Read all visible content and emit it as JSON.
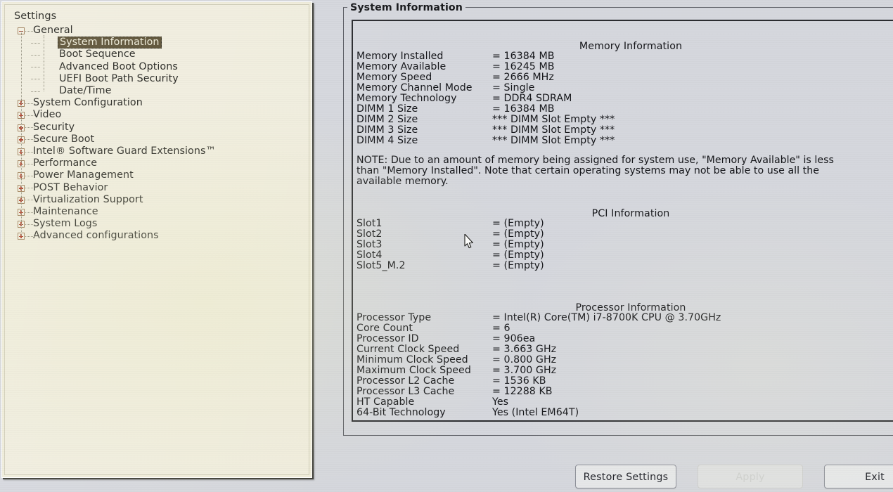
{
  "sidebar": {
    "root_label": "Settings",
    "tree": [
      {
        "label": "General",
        "depth": 1,
        "expander": "minus",
        "selected": false
      },
      {
        "label": "System Information",
        "depth": 2,
        "expander": "none",
        "selected": true
      },
      {
        "label": "Boot Sequence",
        "depth": 2,
        "expander": "none",
        "selected": false
      },
      {
        "label": "Advanced Boot Options",
        "depth": 2,
        "expander": "none",
        "selected": false
      },
      {
        "label": "UEFI Boot Path Security",
        "depth": 2,
        "expander": "none",
        "selected": false
      },
      {
        "label": "Date/Time",
        "depth": 2,
        "expander": "none",
        "selected": false
      },
      {
        "label": "System Configuration",
        "depth": 1,
        "expander": "plus",
        "selected": false
      },
      {
        "label": "Video",
        "depth": 1,
        "expander": "plus",
        "selected": false
      },
      {
        "label": "Security",
        "depth": 1,
        "expander": "plus",
        "selected": false
      },
      {
        "label": "Secure Boot",
        "depth": 1,
        "expander": "plus",
        "selected": false
      },
      {
        "label": "Intel® Software Guard Extensions™",
        "depth": 1,
        "expander": "plus",
        "selected": false
      },
      {
        "label": "Performance",
        "depth": 1,
        "expander": "plus",
        "selected": false
      },
      {
        "label": "Power Management",
        "depth": 1,
        "expander": "plus",
        "selected": false
      },
      {
        "label": "POST Behavior",
        "depth": 1,
        "expander": "plus",
        "selected": false
      },
      {
        "label": "Virtualization Support",
        "depth": 1,
        "expander": "plus",
        "selected": false
      },
      {
        "label": "Maintenance",
        "depth": 1,
        "expander": "plus",
        "selected": false
      },
      {
        "label": "System Logs",
        "depth": 1,
        "expander": "plus",
        "selected": false
      },
      {
        "label": "Advanced configurations",
        "depth": 1,
        "expander": "plus",
        "selected": false
      }
    ]
  },
  "content": {
    "group_title": "System Information",
    "sections": [
      {
        "title": "Memory Information",
        "rows": [
          {
            "key": "Memory Installed",
            "value": "= 16384 MB"
          },
          {
            "key": "Memory Available",
            "value": "= 16245 MB"
          },
          {
            "key": "Memory Speed",
            "value": "= 2666 MHz"
          },
          {
            "key": "Memory Channel Mode",
            "value": "= Single"
          },
          {
            "key": "Memory Technology",
            "value": "= DDR4 SDRAM"
          },
          {
            "key": "DIMM 1 Size",
            "value": "= 16384 MB"
          },
          {
            "key": "DIMM 2 Size",
            "value": "*** DIMM Slot Empty ***"
          },
          {
            "key": "DIMM 3 Size",
            "value": "*** DIMM Slot Empty ***"
          },
          {
            "key": "DIMM 4 Size",
            "value": "*** DIMM Slot Empty ***"
          }
        ],
        "note": "NOTE: Due to an amount of memory being assigned for system use, \"Memory Available\" is less than \"Memory Installed\". Note that certain operating systems may not be able to use all the available memory."
      },
      {
        "title": "PCI Information",
        "rows": [
          {
            "key": "Slot1",
            "value": "= (Empty)"
          },
          {
            "key": "Slot2",
            "value": "= (Empty)"
          },
          {
            "key": "Slot3",
            "value": "= (Empty)"
          },
          {
            "key": "Slot4",
            "value": "= (Empty)"
          },
          {
            "key": "Slot5_M.2",
            "value": "= (Empty)"
          }
        ],
        "note": ""
      },
      {
        "title": "Processor Information",
        "rows": [
          {
            "key": "Processor Type",
            "value": "= Intel(R) Core(TM) i7-8700K CPU @ 3.70GHz"
          },
          {
            "key": "Core Count",
            "value": "= 6"
          },
          {
            "key": "Processor ID",
            "value": "= 906ea"
          },
          {
            "key": "Current Clock Speed",
            "value": "= 3.663 GHz"
          },
          {
            "key": "Minimum Clock Speed",
            "value": "= 0.800 GHz"
          },
          {
            "key": "Maximum Clock Speed",
            "value": "= 3.700 GHz"
          },
          {
            "key": "Processor L2 Cache",
            "value": "= 1536 KB"
          },
          {
            "key": "Processor L3 Cache",
            "value": "= 12288 KB"
          },
          {
            "key": "HT Capable",
            "value": "Yes"
          },
          {
            "key": "64-Bit Technology",
            "value": "Yes (Intel EM64T)"
          }
        ],
        "note": ""
      }
    ]
  },
  "footer": {
    "restore_label": "Restore Settings",
    "apply_label": "Apply",
    "exit_label": "Exit"
  },
  "colors": {
    "sidebar_bg": "#f0edde",
    "content_bg": "#d5d7dd",
    "selection_bg": "#5a4f33",
    "selection_fg": "#efecd8",
    "expander_glyph": "#a8321c",
    "text": "#15161a"
  }
}
